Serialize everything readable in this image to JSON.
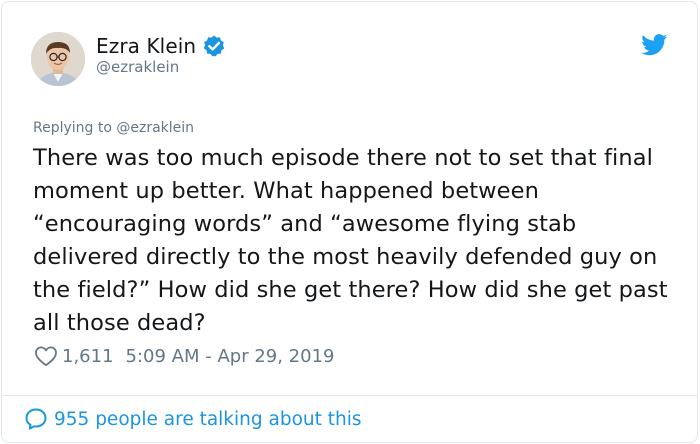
{
  "author": {
    "name": "Ezra Klein",
    "handle": "@ezraklein",
    "verified": true
  },
  "reply_context": "Replying to @ezraklein",
  "tweet_text": "There was too much episode there not to set that final moment up better. What happened between “encouraging words” and “awesome flying stab delivered directly to the most heavily defended guy on the field?” How did she get there? How did she get past all those dead?",
  "meta": {
    "likes": "1,611",
    "timestamp": "5:09 AM - Apr 29, 2019"
  },
  "footer": {
    "talking_text": "955 people are talking about this"
  },
  "colors": {
    "brand_blue": "#1b95e0",
    "muted": "#657786",
    "text": "#14171a",
    "divider": "#e1e8ed"
  },
  "icons": {
    "verified": "verified-badge-icon",
    "twitter": "twitter-bird-icon",
    "like": "heart-icon",
    "conversation": "speech-bubble-icon"
  }
}
